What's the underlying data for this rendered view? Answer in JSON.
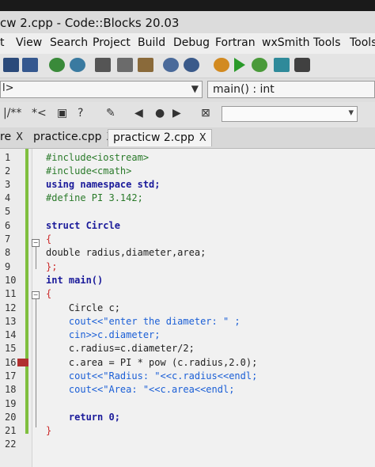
{
  "window": {
    "title": "cw 2.cpp - Code::Blocks 20.03"
  },
  "menu": [
    "t",
    "View",
    "Search",
    "Project",
    "Build",
    "Debug",
    "Fortran",
    "wxSmith",
    "Tools",
    "Tools"
  ],
  "scope": {
    "left_text": "l>",
    "function": "main() : int"
  },
  "tabs": [
    {
      "label": "re",
      "close": "X"
    },
    {
      "label": "practice.cpp",
      "close": "X"
    },
    {
      "label": "practicw 2.cpp",
      "close": "X"
    }
  ],
  "code": {
    "line_numbers": [
      "1",
      "2",
      "3",
      "4",
      "5",
      "6",
      "7",
      "8",
      "9",
      "10",
      "11",
      "12",
      "13",
      "14",
      "15",
      "16",
      "17",
      "18",
      "19",
      "20",
      "21",
      "22"
    ],
    "lines": [
      "#include<iostream>",
      "#include<cmath>",
      "using namespace std;",
      "#define PI 3.142;",
      "",
      "struct Circle",
      "{",
      "double radius,diameter,area;",
      "};",
      "int main()",
      "{",
      "    Circle c;",
      "    cout<<\"enter the diameter: \" ;",
      "    cin>>c.diameter;",
      "    c.radius=c.diameter/2;",
      "    c.area = PI * pow (c.radius,2.0);",
      "    cout<<\"Radius: \"<<c.radius<<endl;",
      "    cout<<\"Area: \"<<c.area<<endl;",
      "",
      "    return 0;",
      "}",
      ""
    ]
  },
  "icons": {
    "save": "save-icon",
    "save_all": "save-all-icon",
    "undo": "undo-icon",
    "redo": "redo-icon",
    "cut": "cut-icon",
    "copy": "copy-icon",
    "paste": "paste-icon",
    "find": "find-icon",
    "replace": "replace-icon",
    "settings": "gear-icon",
    "run": "run-icon",
    "build_run": "build-run-icon",
    "rebuild": "rebuild-icon",
    "abort": "abort-icon"
  },
  "colors": {
    "preprocessor": "#2a7a2a",
    "keyword": "#1a1a9a",
    "string": "#1b5fd6",
    "number": "#cc2a2a",
    "change_bar": "#7fbf3f",
    "breakpoint": "#b03030"
  }
}
